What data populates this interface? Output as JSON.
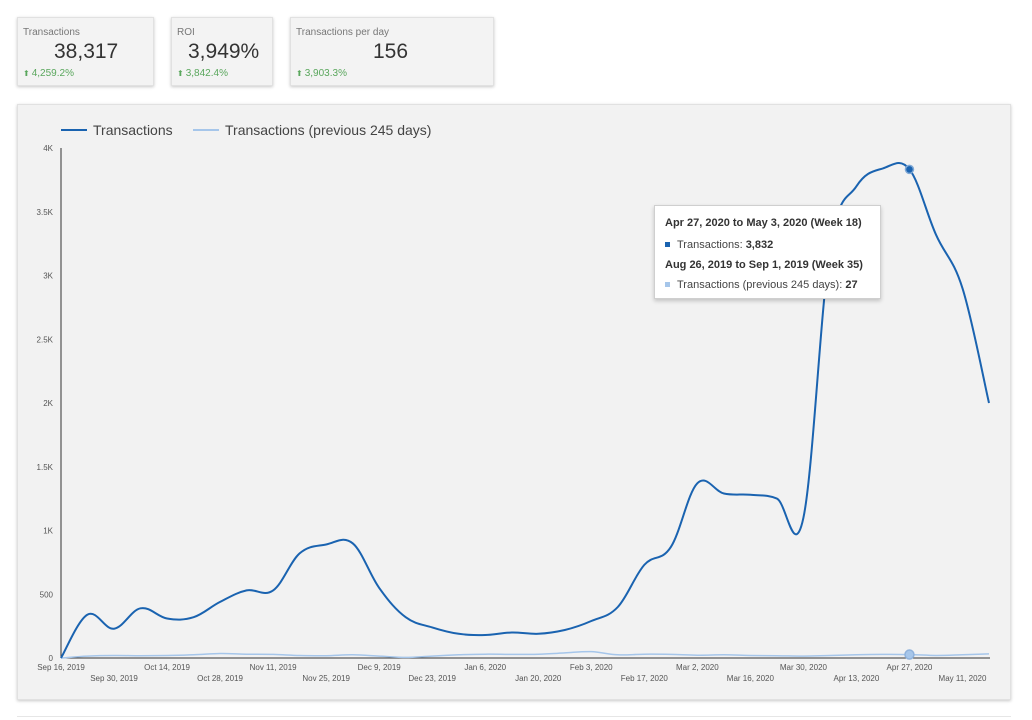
{
  "kpis": [
    {
      "label": "Transactions",
      "value": "38,317",
      "change": "4,259.2%"
    },
    {
      "label": "ROI",
      "value": "3,949%",
      "change": "3,842.4%"
    },
    {
      "label": "Transactions per day",
      "value": "156",
      "change": "3,903.3%"
    }
  ],
  "colors": {
    "primary": "#1a63b0",
    "secondary": "#a6c6ea",
    "positive": "#5aa75d"
  },
  "tooltip": {
    "current_period": "Apr 27, 2020 to May 3, 2020 (Week 18)",
    "current_label": "Transactions: ",
    "current_value": "3,832",
    "previous_period": "Aug 26, 2019 to Sep 1, 2019 (Week 35)",
    "previous_label": "Transactions (previous 245 days): ",
    "previous_value": "27"
  },
  "chart_data": {
    "type": "line",
    "x": [
      "Sep 16, 2019",
      "Sep 23, 2019",
      "Sep 30, 2019",
      "Oct 7, 2019",
      "Oct 14, 2019",
      "Oct 21, 2019",
      "Oct 28, 2019",
      "Nov 4, 2019",
      "Nov 11, 2019",
      "Nov 18, 2019",
      "Nov 25, 2019",
      "Dec 2, 2019",
      "Dec 9, 2019",
      "Dec 16, 2019",
      "Dec 23, 2019",
      "Dec 30, 2019",
      "Jan 6, 2020",
      "Jan 13, 2020",
      "Jan 20, 2020",
      "Jan 27, 2020",
      "Feb 3, 2020",
      "Feb 10, 2020",
      "Feb 17, 2020",
      "Feb 24, 2020",
      "Mar 2, 2020",
      "Mar 9, 2020",
      "Mar 16, 2020",
      "Mar 23, 2020",
      "Mar 30, 2020",
      "Apr 6, 2020",
      "Apr 13, 2020",
      "Apr 20, 2020",
      "Apr 27, 2020",
      "May 4, 2020",
      "May 11, 2020",
      "May 18, 2020"
    ],
    "x_tick_labels": [
      "Sep 16, 2019",
      "Sep 30, 2019",
      "Oct 14, 2019",
      "Oct 28, 2019",
      "Nov 11, 2019",
      "Nov 25, 2019",
      "Dec 9, 2019",
      "Dec 23, 2019",
      "Jan 6, 2020",
      "Jan 20, 2020",
      "Feb 3, 2020",
      "Feb 17, 2020",
      "Mar 2, 2020",
      "Mar 16, 2020",
      "Mar 30, 2020",
      "Apr 13, 2020",
      "Apr 27, 2020",
      "May 11, 2020"
    ],
    "y_tick_labels": [
      "0",
      "500",
      "1K",
      "1.5K",
      "2K",
      "2.5K",
      "3K",
      "3.5K",
      "4K"
    ],
    "ylim": [
      0,
      4000
    ],
    "series": [
      {
        "name": "Transactions",
        "values": [
          0,
          340,
          230,
          390,
          310,
          320,
          440,
          530,
          530,
          820,
          890,
          900,
          550,
          320,
          240,
          190,
          180,
          200,
          190,
          220,
          290,
          400,
          730,
          870,
          1370,
          1290,
          1280,
          1250,
          1100,
          3200,
          3700,
          3840,
          3832,
          3320,
          2900,
          2000
        ]
      },
      {
        "name": "Transactions (previous 245 days)",
        "values": [
          0,
          15,
          20,
          18,
          20,
          25,
          35,
          30,
          28,
          20,
          18,
          25,
          15,
          5,
          15,
          25,
          30,
          28,
          30,
          40,
          50,
          25,
          30,
          28,
          22,
          25,
          20,
          18,
          15,
          20,
          25,
          28,
          27,
          20,
          25,
          32
        ]
      }
    ],
    "legend": "top-left",
    "grid": false,
    "highlighted_index": 32
  }
}
